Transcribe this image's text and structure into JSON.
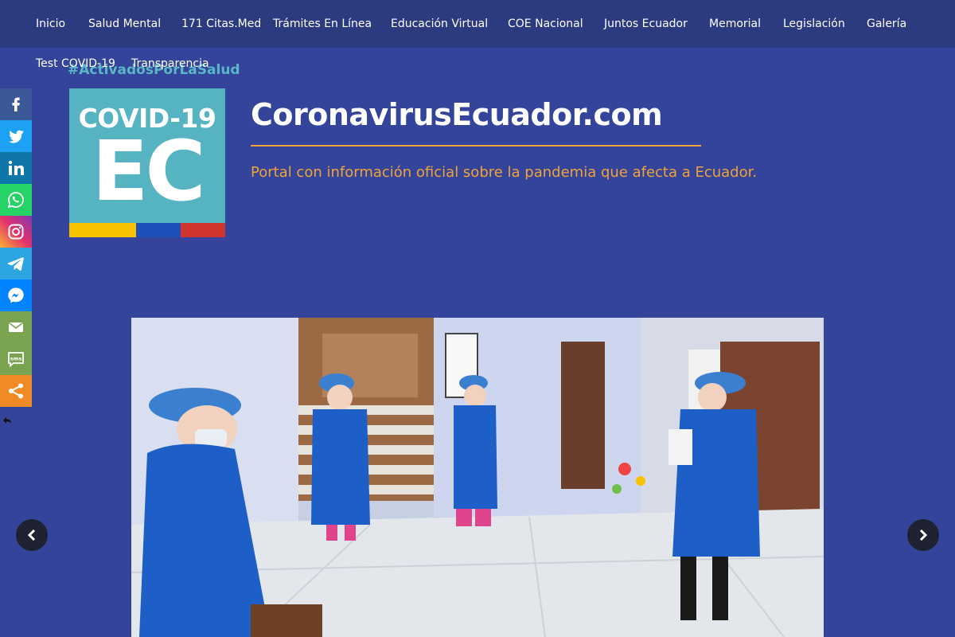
{
  "nav": {
    "items": [
      {
        "label": "Inicio"
      },
      {
        "label": "Salud Mental"
      },
      {
        "label": "171 Citas.Med"
      },
      {
        "label": "Trámites En Línea"
      },
      {
        "label": "Educación Virtual"
      },
      {
        "label": "COE Nacional"
      },
      {
        "label": "Juntos Ecuador"
      },
      {
        "label": "Memorial"
      },
      {
        "label": "Legislación"
      },
      {
        "label": "Galería"
      },
      {
        "label": "Test COVID-19"
      },
      {
        "label": "Transparencia"
      }
    ]
  },
  "header": {
    "hashtag": "#ActivadosPorLaSalud",
    "logo_line1": "COVID-19",
    "logo_line2": "EC",
    "site_title": "CoronavirusEcuador.com",
    "tagline": "Portal con información oficial sobre la pandemia que afecta a Ecuador."
  },
  "share": {
    "buttons": [
      {
        "icon": "facebook-icon",
        "color": "#3b5998"
      },
      {
        "icon": "twitter-icon",
        "color": "#1da1f2"
      },
      {
        "icon": "linkedin-icon",
        "color": "#0e76a8"
      },
      {
        "icon": "whatsapp-icon",
        "color": "#25d366"
      },
      {
        "icon": "instagram-icon",
        "color": "#c13584"
      },
      {
        "icon": "telegram-icon",
        "color": "#2ca5e0"
      },
      {
        "icon": "messenger-icon",
        "color": "#0084ff"
      },
      {
        "icon": "email-icon",
        "color": "#7aa34f"
      },
      {
        "icon": "sms-icon",
        "color": "#7aa34f"
      },
      {
        "icon": "share-icon",
        "color": "#f08a24"
      }
    ]
  },
  "colors": {
    "background": "#33449a",
    "nav_bar": "#2c3a7f",
    "accent": "#f0a33a",
    "logo_teal": "#56b3c2",
    "flag_yellow": "#f7c300",
    "flag_blue": "#1d4fb8",
    "flag_red": "#d0342c"
  },
  "slider": {
    "prev_icon": "chevron-left-icon",
    "next_icon": "chevron-right-icon"
  }
}
